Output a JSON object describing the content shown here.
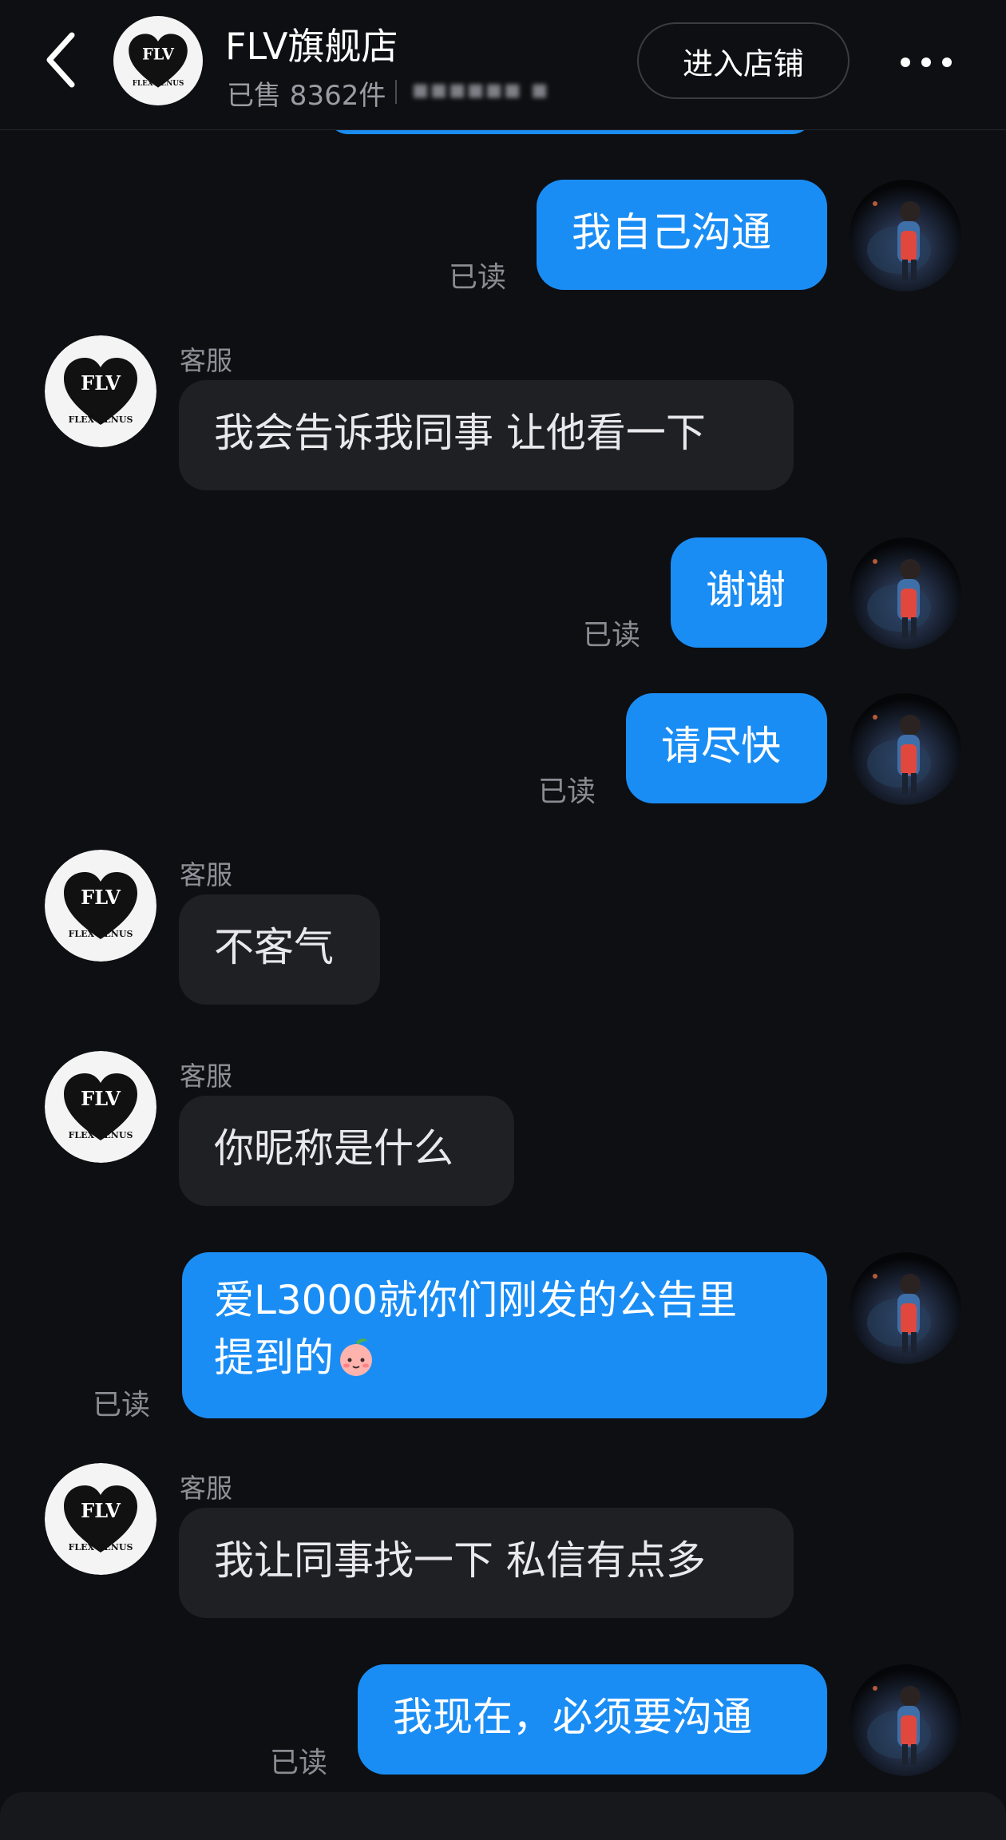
{
  "header": {
    "store_name": "FLV旗舰店",
    "sold_count": "已售 8362件",
    "sold_extra": "▪▪▪▪▪▪ ▪",
    "enter_store_label": "进入店铺",
    "logo_text": "FLV",
    "logo_subtext": "FLEX VENUS"
  },
  "messages": [
    {
      "direction": "out",
      "text": "我自己沟通",
      "read_label": "已读"
    },
    {
      "direction": "in",
      "sender": "客服",
      "text": "我会告诉我同事 让他看一下"
    },
    {
      "direction": "out",
      "text": "谢谢",
      "read_label": "已读"
    },
    {
      "direction": "out",
      "text": "请尽快",
      "read_label": "已读"
    },
    {
      "direction": "in",
      "sender": "客服",
      "text": "不客气"
    },
    {
      "direction": "in",
      "sender": "客服",
      "text": "你昵称是什么"
    },
    {
      "direction": "out",
      "text_line1": "爱L3000就你们刚发的公告里",
      "text_line2": "提到的",
      "emoji": "peach-face-emoji",
      "read_label": "已读"
    },
    {
      "direction": "in",
      "sender": "客服",
      "text": "我让同事找一下 私信有点多"
    },
    {
      "direction": "out",
      "text": "我现在，必须要沟通",
      "read_label": "已读"
    }
  ],
  "colors": {
    "background": "#0e0f12",
    "outgoing_bubble": "#1a8df5",
    "incoming_bubble": "#1f2024",
    "muted_text": "#8a8c93"
  },
  "icons": [
    "back-arrow-icon",
    "more-dots-icon",
    "flv-heart-logo",
    "user-avatar"
  ]
}
